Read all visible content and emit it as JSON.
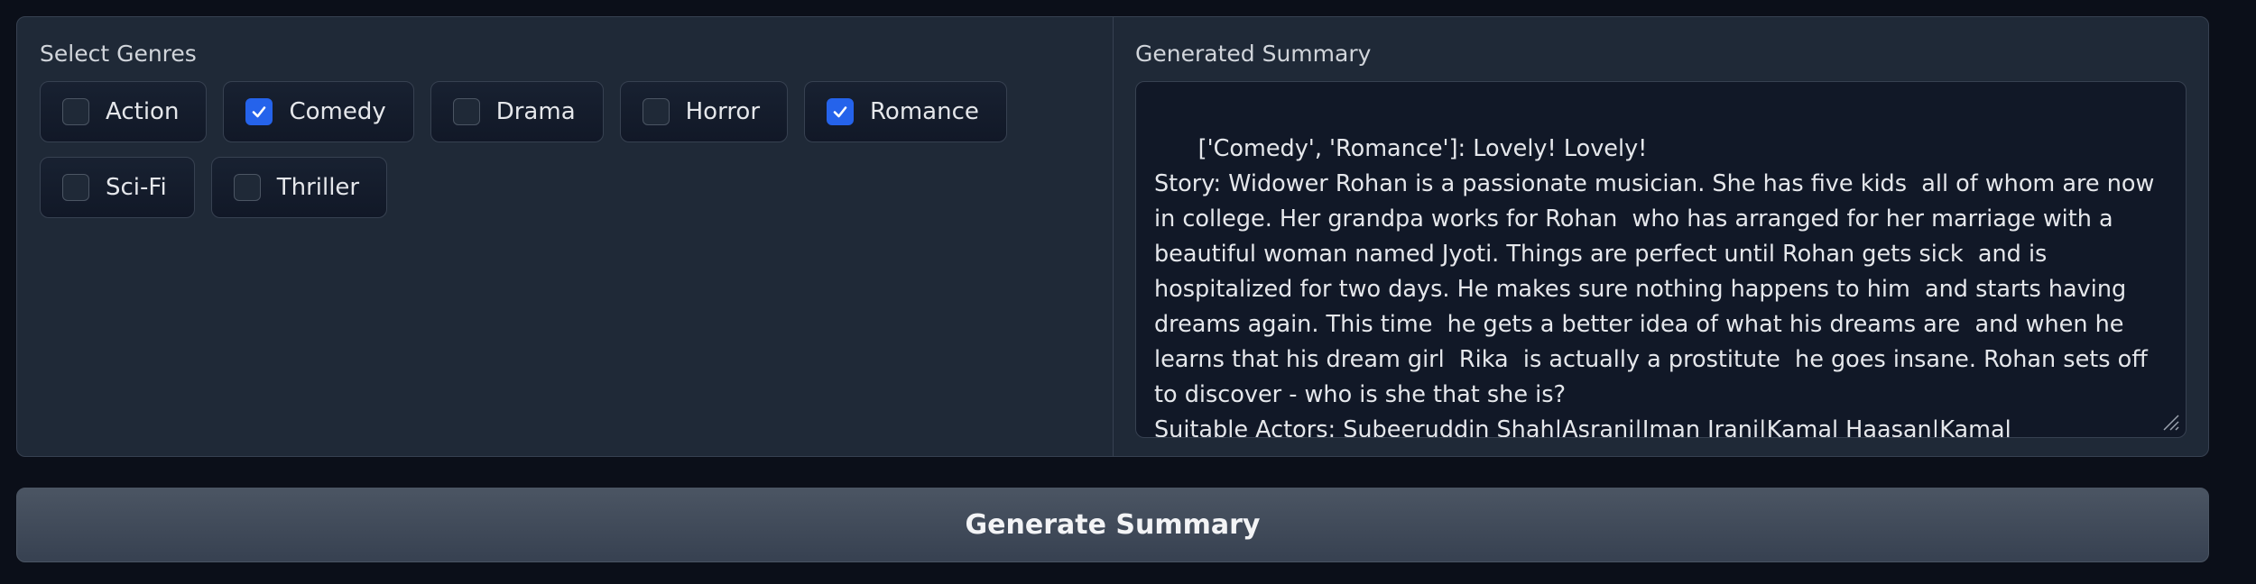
{
  "genres": {
    "label": "Select Genres",
    "options": [
      {
        "label": "Action",
        "checked": false
      },
      {
        "label": "Comedy",
        "checked": true
      },
      {
        "label": "Drama",
        "checked": false
      },
      {
        "label": "Horror",
        "checked": false
      },
      {
        "label": "Romance",
        "checked": true
      },
      {
        "label": "Sci-Fi",
        "checked": false
      },
      {
        "label": "Thriller",
        "checked": false
      }
    ]
  },
  "summary": {
    "label": "Generated Summary",
    "value": "['Comedy', 'Romance']: Lovely! Lovely!\nStory: Widower Rohan is a passionate musician. She has five kids  all of whom are now in college. Her grandpa works for Rohan  who has arranged for her marriage with a beautiful woman named Jyoti. Things are perfect until Rohan gets sick  and is hospitalized for two days. He makes sure nothing happens to him  and starts having dreams again. This time  he gets a better idea of what his dreams are  and when he learns that his dream girl  Rika  is actually a prostitute  he goes insane. Rohan sets off to discover - who is she that she is?\nSuitable Actors: Subeeruddin Shah|Asrani|Iman Irani|Kamal Haasan|Kamal Haasan|Dulari|Pankaj Kapur|"
  },
  "actions": {
    "generate_label": "Generate Summary"
  },
  "colors": {
    "background": "#0b0f19",
    "panel": "#1f2937",
    "border": "#374151",
    "accent": "#2563eb"
  }
}
